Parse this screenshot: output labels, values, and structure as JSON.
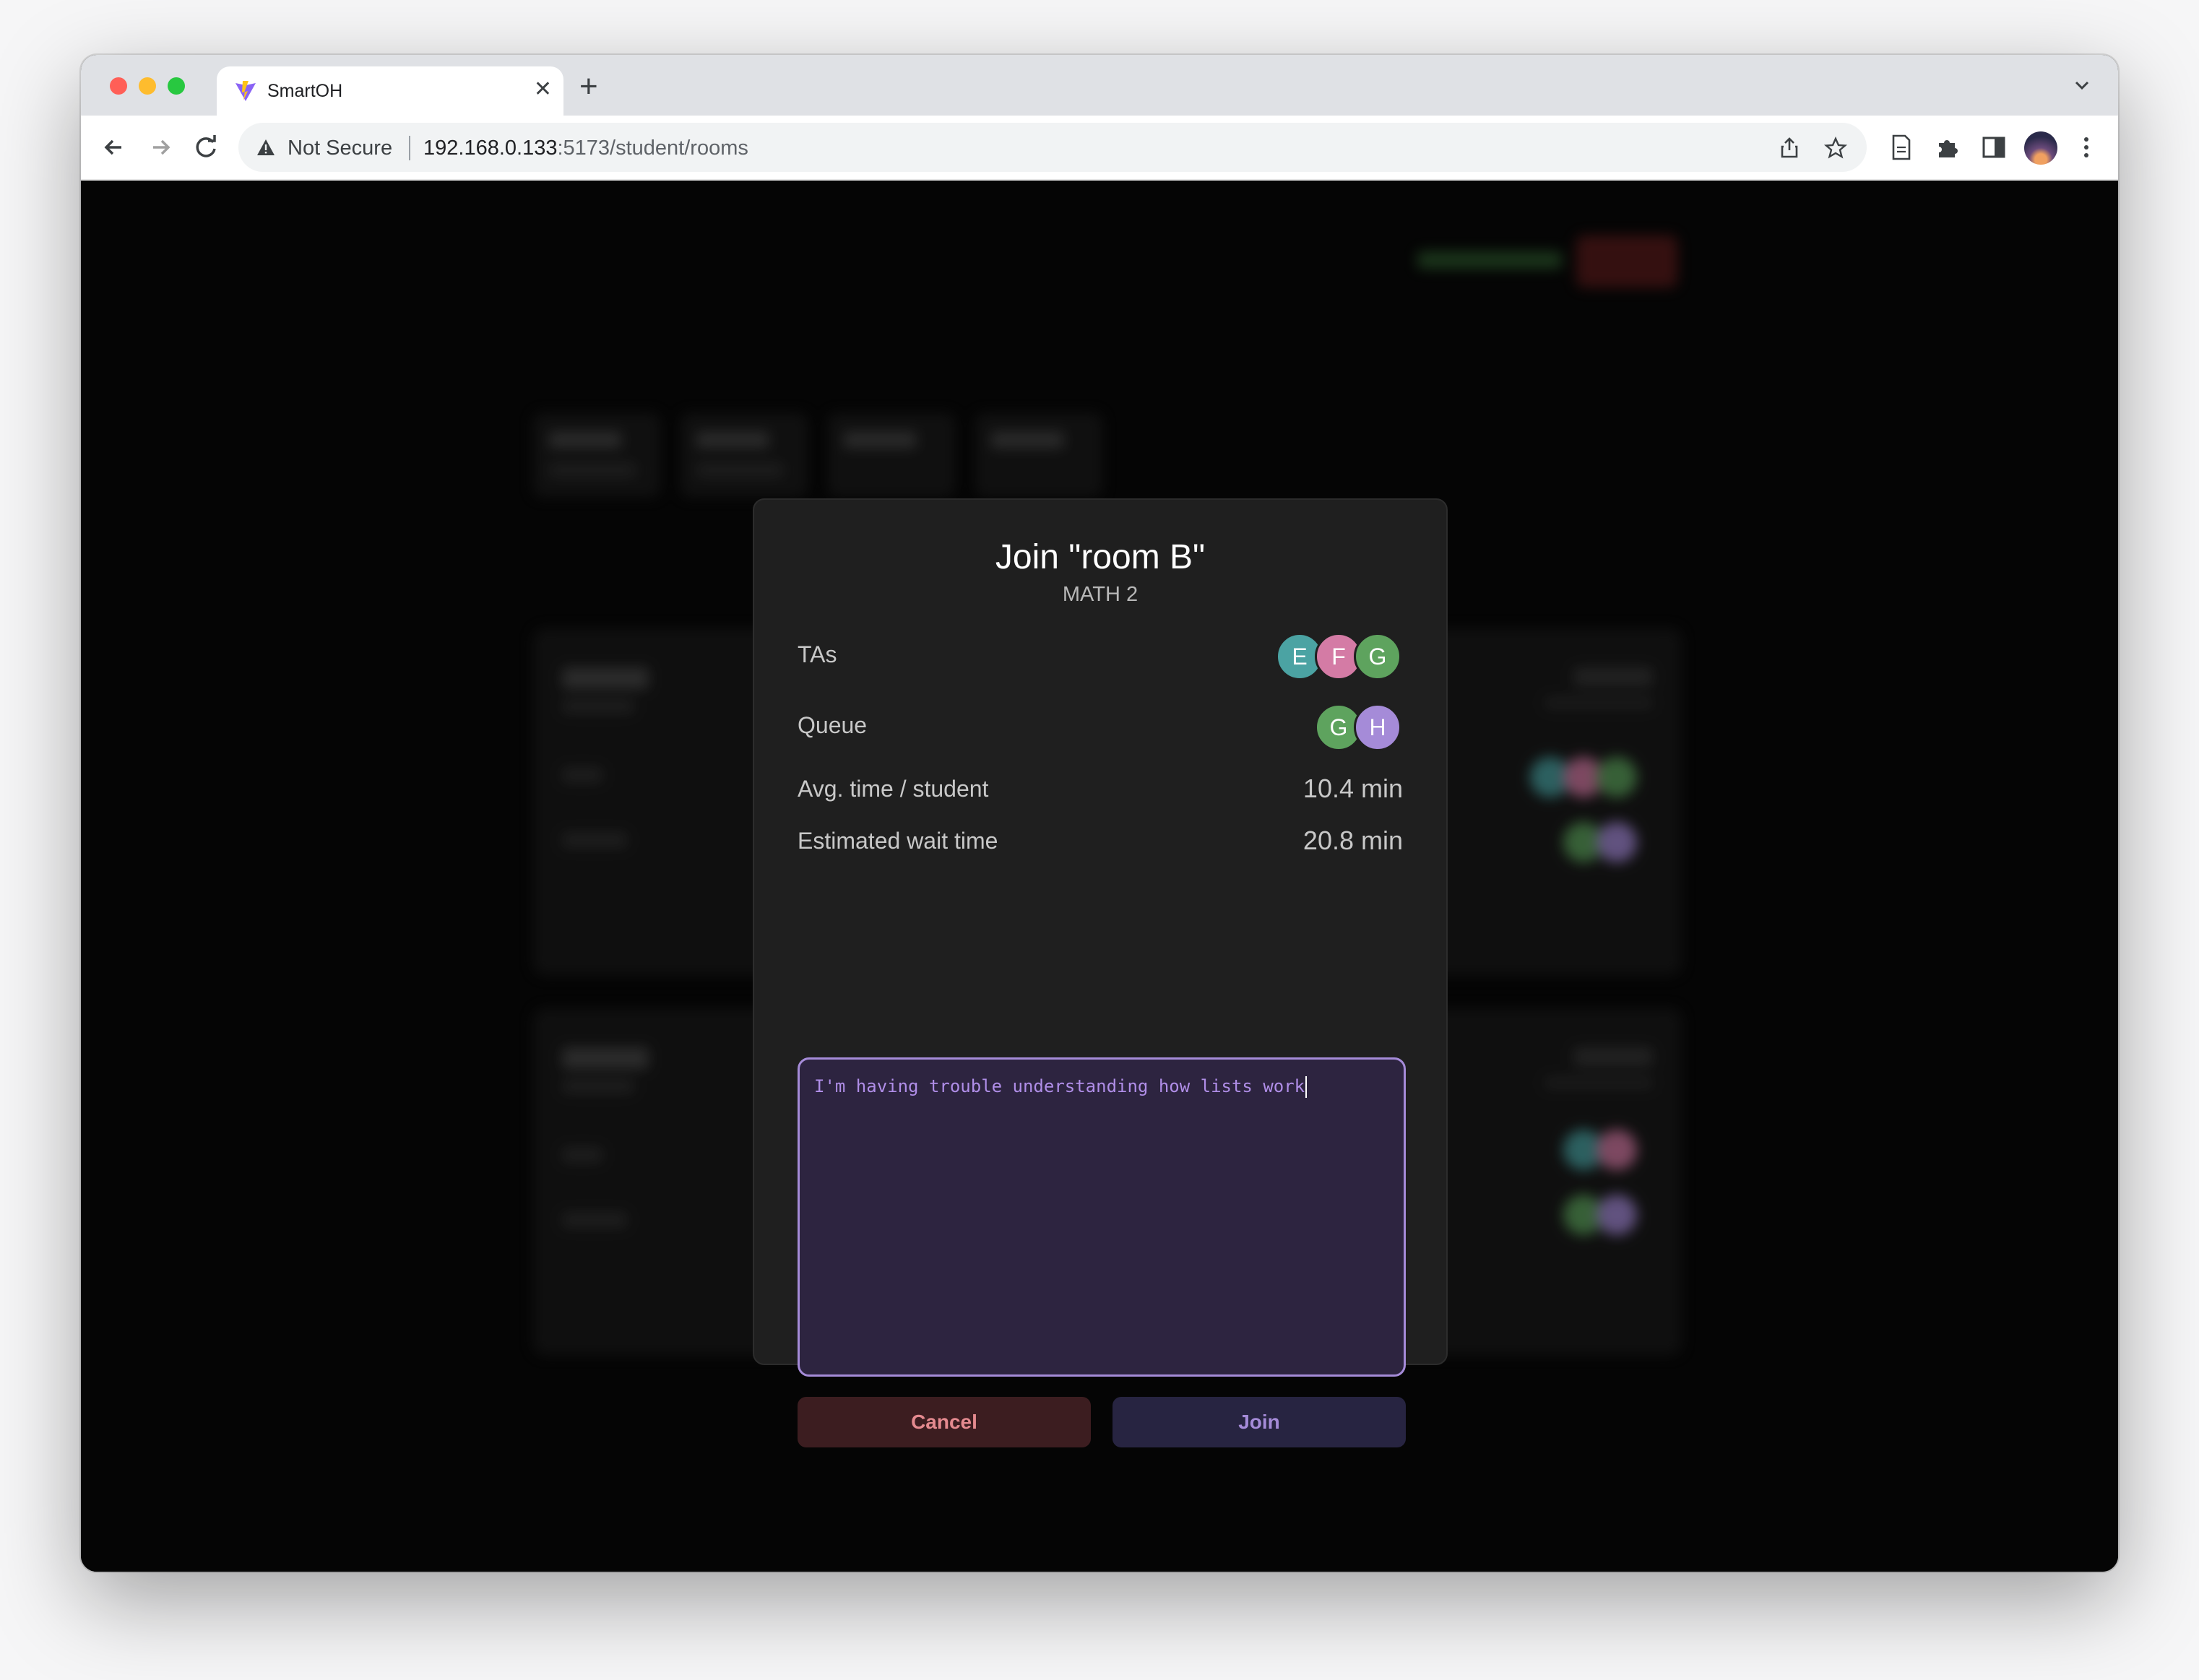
{
  "browser": {
    "tab_title": "SmartOH",
    "security_label": "Not Secure",
    "url_host": "192.168.0.133",
    "url_rest": ":5173/student/rooms"
  },
  "modal": {
    "title": "Join \"room B\"",
    "subtitle": "MATH 2",
    "tas_label": "TAs",
    "tas": [
      {
        "initial": "E",
        "color": "#4ba3a3"
      },
      {
        "initial": "F",
        "color": "#d47ba5"
      },
      {
        "initial": "G",
        "color": "#5ea35e"
      }
    ],
    "queue_label": "Queue",
    "queue": [
      {
        "initial": "G",
        "color": "#5ea35e"
      },
      {
        "initial": "H",
        "color": "#a58bd8"
      }
    ],
    "avg_time_label": "Avg. time / student",
    "avg_time_value": "10.4 min",
    "wait_label": "Estimated wait time",
    "wait_value": "20.8 min",
    "question_text": "I'm having trouble understanding how lists work",
    "cancel_label": "Cancel",
    "join_label": "Join"
  },
  "colors": {
    "accent": "#a58bd8",
    "danger": "#e48a8f",
    "modal_bg": "#1f1f1f"
  }
}
